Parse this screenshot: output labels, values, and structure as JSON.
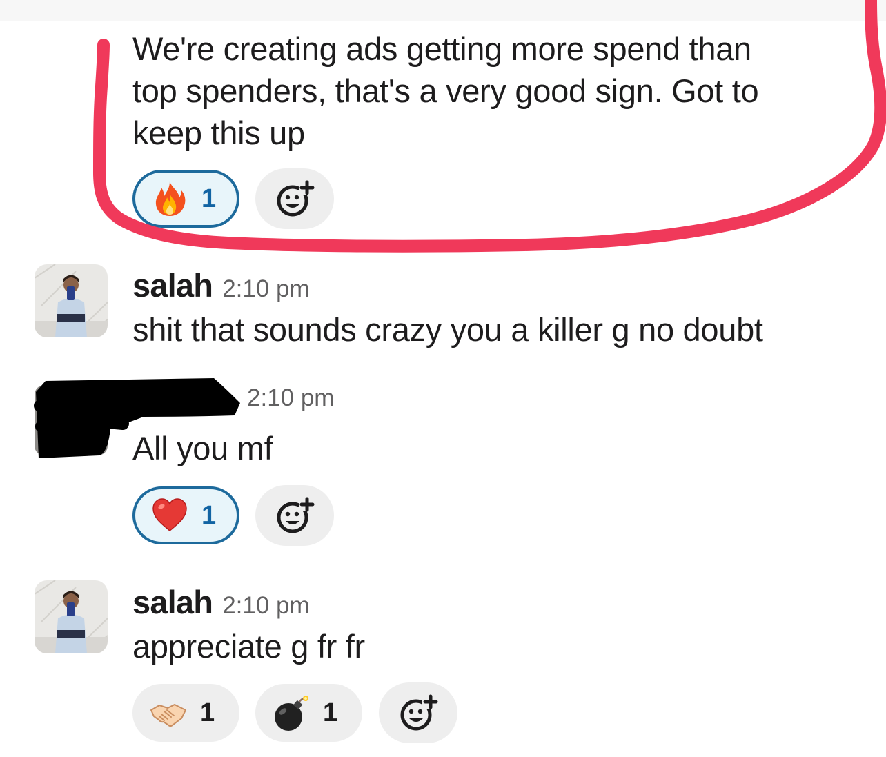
{
  "messages": [
    {
      "text": "We're creating ads getting more spend than\ntop spenders, that's a very good sign. Got to\nkeep this up",
      "reactions": [
        {
          "icon": "fire-emoji",
          "count": "1",
          "active": true
        }
      ]
    },
    {
      "author": "salah",
      "time": "2:10 pm",
      "text": "shit that sounds crazy you a killer g no doubt"
    },
    {
      "author": "",
      "time": "2:10 pm",
      "text": "All you mf",
      "author_redacted": true,
      "reactions": [
        {
          "icon": "red-heart-emoji",
          "count": "1",
          "active": true
        }
      ]
    },
    {
      "author": "salah",
      "time": "2:10 pm",
      "text": "appreciate g fr fr",
      "reactions": [
        {
          "icon": "handshake-emoji",
          "count": "1",
          "active": false
        },
        {
          "icon": "bomb-emoji",
          "count": "1",
          "active": false
        }
      ]
    }
  ],
  "add_reaction_icon": "add-reaction-icon",
  "colors": {
    "text": "#1d1c1d",
    "timestamp": "#616061",
    "reaction_active_border": "#1d6a9c",
    "reaction_active_bg": "#e8f5fa",
    "reaction_bg": "#eeeeee",
    "annotation_red": "#f0395a"
  }
}
